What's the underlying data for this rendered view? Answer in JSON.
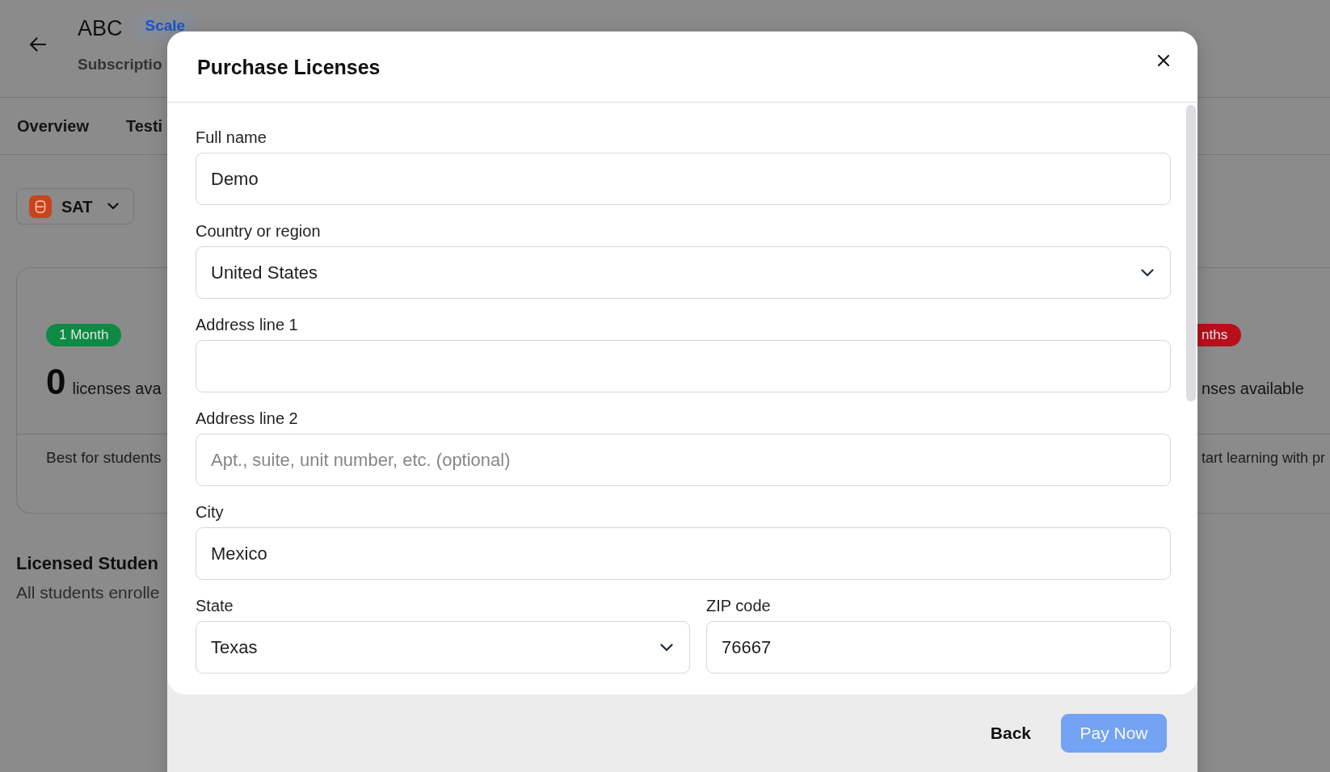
{
  "page": {
    "title": "ABC",
    "plan_badge": "Scale",
    "subtitle": "Subscriptio",
    "tabs": [
      {
        "label": "Overview"
      },
      {
        "label": "Testi"
      }
    ],
    "exam_selector": {
      "value": "SAT"
    },
    "plans": [
      {
        "badge": "1 Month",
        "color": "#0f8a45",
        "count": "0",
        "count_label": "licenses ava",
        "description": "Best for students"
      },
      {
        "badge": "nths",
        "color": "#b80f1d",
        "count_label": "nses available",
        "description": "tart learning with pr"
      }
    ],
    "students_section": {
      "title": "Licensed Studen",
      "subtitle": "All students enrolle"
    }
  },
  "dialog": {
    "title": "Purchase Licenses",
    "rows": [
      {
        "fields": [
          {
            "kind": "text",
            "label": "Full name",
            "value": "Demo"
          }
        ]
      },
      {
        "fields": [
          {
            "kind": "select",
            "label": "Country or region",
            "value": "United States"
          }
        ]
      },
      {
        "fields": [
          {
            "kind": "text",
            "label": "Address line 1"
          }
        ]
      },
      {
        "fields": [
          {
            "kind": "text",
            "label": "Address line 2",
            "placeholder": "Apt., suite, unit number, etc. (optional)"
          }
        ]
      },
      {
        "fields": [
          {
            "kind": "text",
            "label": "City",
            "value": "Mexico"
          }
        ]
      },
      {
        "fields": [
          {
            "kind": "select",
            "label": "State",
            "value": "Texas"
          },
          {
            "kind": "text",
            "label": "ZIP code",
            "value": "76667"
          }
        ]
      }
    ],
    "buttons": [
      {
        "kind": "link",
        "label": "Back",
        "disabled": false
      },
      {
        "kind": "primary",
        "label": "Pay Now",
        "disabled": true
      }
    ]
  }
}
